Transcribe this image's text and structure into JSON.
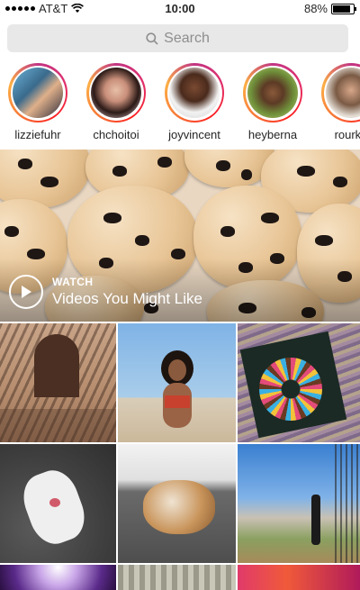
{
  "status_bar": {
    "signal": "●●●●●",
    "carrier": "AT&T",
    "time": "10:00",
    "battery_percent": "88%",
    "battery_level": 0.88
  },
  "search": {
    "placeholder": "Search",
    "icon": "search-icon"
  },
  "stories": [
    {
      "username": "lizziefuhr"
    },
    {
      "username": "chchoitoi"
    },
    {
      "username": "joyvincent"
    },
    {
      "username": "heyberna"
    },
    {
      "username": "rourke"
    }
  ],
  "featured_video": {
    "kicker": "WATCH",
    "title": "Videos You Might Like",
    "icon": "play-icon"
  },
  "explore_grid": [
    {
      "name": "courtyard-shadows-photo"
    },
    {
      "name": "beach-woman-photo"
    },
    {
      "name": "sprinkle-donut-photo"
    },
    {
      "name": "white-dog-photo"
    },
    {
      "name": "sleeping-cat-photo"
    },
    {
      "name": "hilltop-view-photo"
    },
    {
      "name": "purple-light-photo"
    },
    {
      "name": "glass-roof-photo"
    },
    {
      "name": "pink-wall-photo"
    }
  ]
}
